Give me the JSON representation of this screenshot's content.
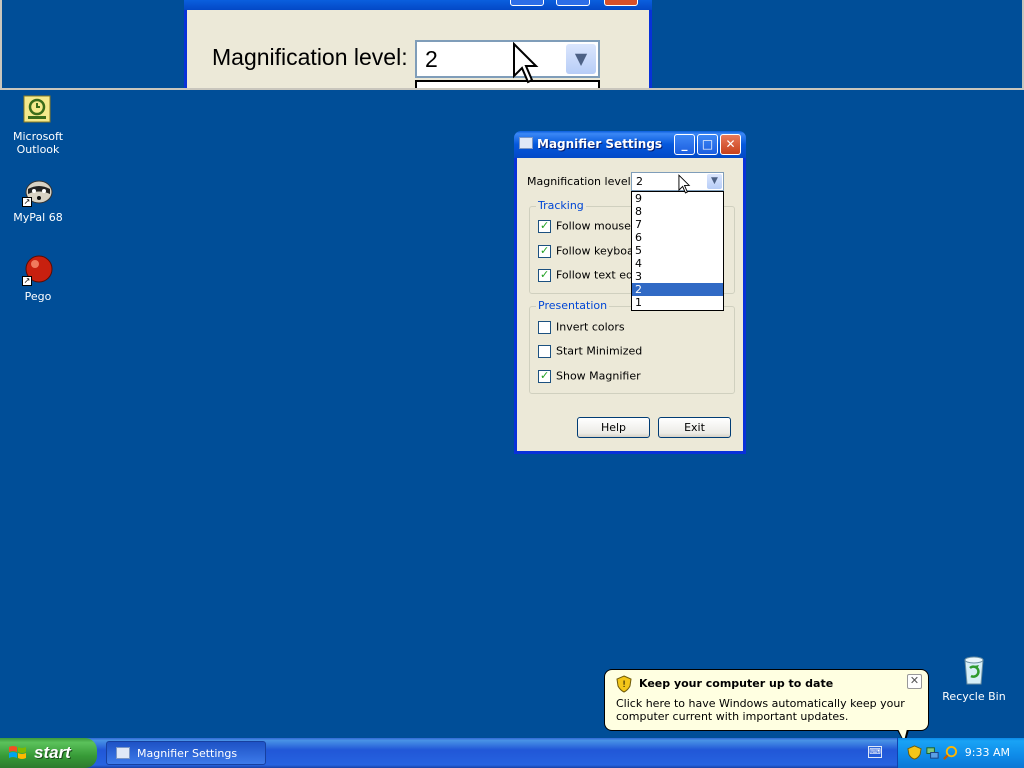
{
  "magnifier_view": {
    "label": "Magnification level:",
    "value": "2"
  },
  "desktop_icons": [
    {
      "label": "Microsoft Outlook"
    },
    {
      "label": "MyPal 68"
    },
    {
      "label": "Pego"
    },
    {
      "label": "Recycle Bin"
    }
  ],
  "settings_window": {
    "title": "Magnifier Settings",
    "magnification_label": "Magnification level:",
    "magnification_value": "2",
    "dropdown_options": [
      "9",
      "8",
      "7",
      "6",
      "5",
      "4",
      "3",
      "2",
      "1"
    ],
    "selected_option": "2",
    "tracking": {
      "title": "Tracking",
      "items": [
        {
          "label": "Follow mouse cu",
          "checked": true
        },
        {
          "label": "Follow keyboard",
          "checked": true
        },
        {
          "label": "Follow text editi",
          "checked": true
        }
      ]
    },
    "presentation": {
      "title": "Presentation",
      "items": [
        {
          "label": "Invert colors",
          "checked": false
        },
        {
          "label": "Start Minimized",
          "checked": false
        },
        {
          "label": "Show Magnifier",
          "checked": true
        }
      ]
    },
    "help_label": "Help",
    "exit_label": "Exit"
  },
  "balloon": {
    "title": "Keep your computer up to date",
    "text": "Click here to have Windows automatically keep your computer current with important updates."
  },
  "taskbar": {
    "start_label": "start",
    "task_label": "Magnifier Settings",
    "clock": "9:33 AM"
  },
  "colors": {
    "desktop": "#004e98",
    "title_blue": "#0458dc",
    "selection": "#316ac5",
    "start_green": "#3c9a3c"
  }
}
